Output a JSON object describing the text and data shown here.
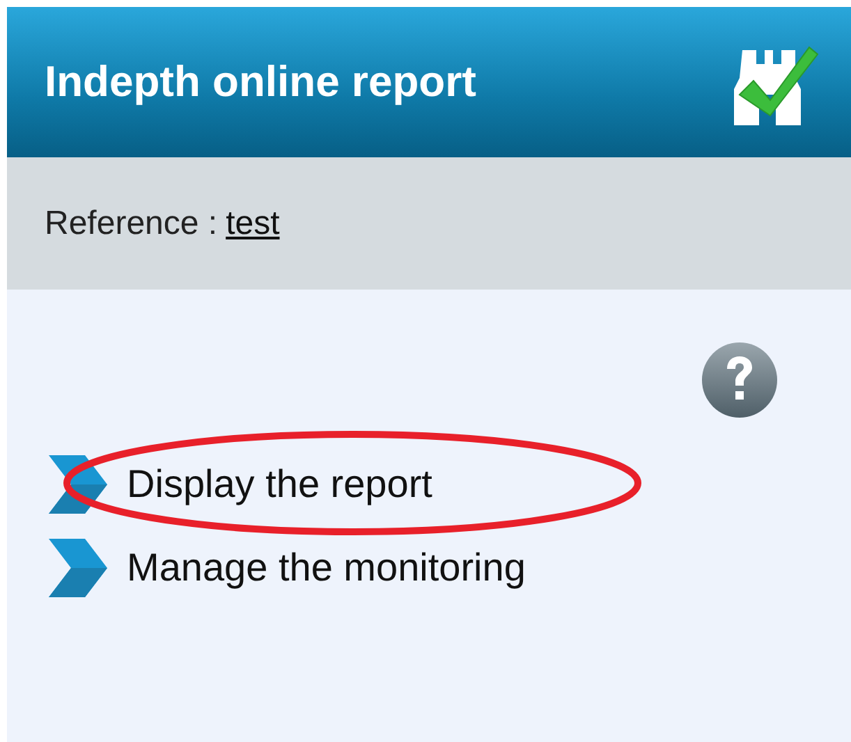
{
  "header": {
    "title": "Indepth online report"
  },
  "reference": {
    "label": "Reference :",
    "value": "test"
  },
  "menu": [
    {
      "label": "Display the report",
      "circled": true
    },
    {
      "label": "Manage the monitoring",
      "circled": false
    }
  ]
}
